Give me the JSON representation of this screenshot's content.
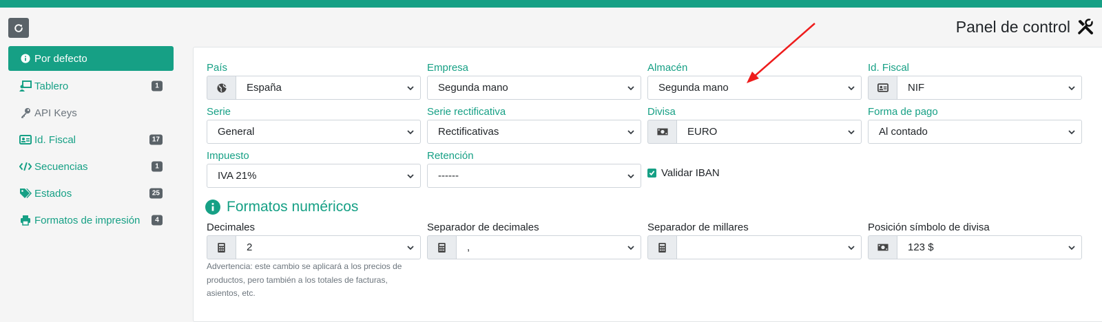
{
  "header": {
    "title": "Panel de control",
    "brand_color": "#16a085"
  },
  "sidebar": {
    "items": [
      {
        "label": "Por defecto",
        "icon": "info-circle-icon",
        "active": true,
        "badge": null
      },
      {
        "label": "Tablero",
        "icon": "chalkboard-user-icon",
        "badge": "1"
      },
      {
        "label": "API Keys",
        "icon": "key-icon",
        "badge": null,
        "muted": true
      },
      {
        "label": "Id. Fiscal",
        "icon": "id-card-icon",
        "badge": "17"
      },
      {
        "label": "Secuencias",
        "icon": "code-icon",
        "badge": "1"
      },
      {
        "label": "Estados",
        "icon": "tags-icon",
        "badge": "25"
      },
      {
        "label": "Formatos de impresión",
        "icon": "print-icon",
        "badge": "4"
      }
    ]
  },
  "form": {
    "pais": {
      "label": "País",
      "value": "España",
      "icon": "globe-icon"
    },
    "empresa": {
      "label": "Empresa",
      "value": "Segunda mano"
    },
    "almacen": {
      "label": "Almacén",
      "value": "Segunda mano"
    },
    "idfiscal": {
      "label": "Id. Fiscal",
      "value": "NIF",
      "icon": "id-card-icon"
    },
    "serie": {
      "label": "Serie",
      "value": "General"
    },
    "serie_rect": {
      "label": "Serie rectificativa",
      "value": "Rectificativas"
    },
    "divisa": {
      "label": "Divisa",
      "value": "EURO",
      "icon": "money-bill-icon"
    },
    "forma_pago": {
      "label": "Forma de pago",
      "value": "Al contado"
    },
    "impuesto": {
      "label": "Impuesto",
      "value": "IVA 21%"
    },
    "retencion": {
      "label": "Retención",
      "value": "------"
    },
    "validar_iban": {
      "label": "Validar IBAN",
      "checked": true
    }
  },
  "numeric": {
    "title": "Formatos numéricos",
    "decimales": {
      "label": "Decimales",
      "value": "2",
      "icon": "calculator-icon"
    },
    "sep_decimales": {
      "label": "Separador de decimales",
      "value": ",",
      "icon": "calculator-icon"
    },
    "sep_millares": {
      "label": "Separador de millares",
      "value": "",
      "icon": "calculator-icon"
    },
    "pos_divisa": {
      "label": "Posición símbolo de divisa",
      "value": "123 $",
      "icon": "money-bill-icon"
    },
    "warning": "Advertencia: este cambio se aplicará a los precios de productos, pero también a los totales de facturas, asientos, etc."
  }
}
